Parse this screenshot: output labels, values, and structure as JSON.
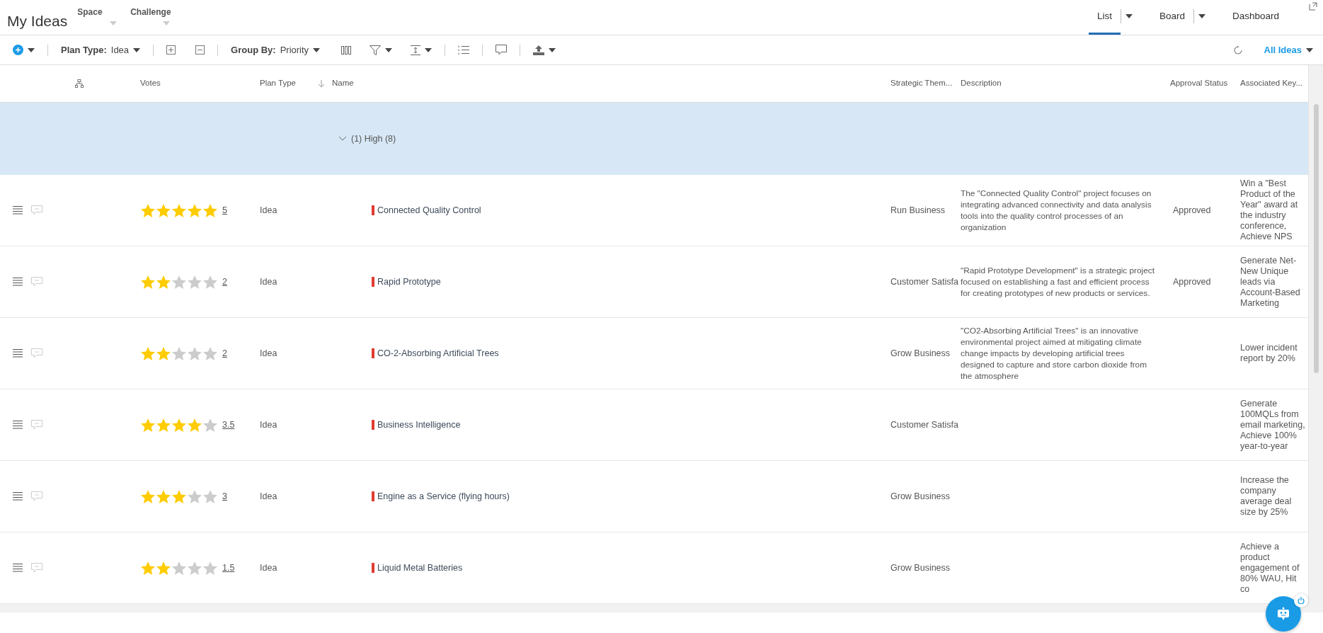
{
  "header": {
    "title": "My Ideas",
    "filters": [
      {
        "label": "Space"
      },
      {
        "label": "Challenge"
      }
    ],
    "views": [
      {
        "label": "List",
        "selected": true,
        "has_menu": true
      },
      {
        "label": "Board",
        "selected": false,
        "has_menu": true
      },
      {
        "label": "Dashboard",
        "selected": false,
        "has_menu": false
      }
    ]
  },
  "toolbar": {
    "plan_type": {
      "label": "Plan Type:",
      "value": "Idea"
    },
    "group_by": {
      "label": "Group By:",
      "value": "Priority"
    },
    "view_filter": "All Ideas"
  },
  "table": {
    "columns": [
      {
        "label": "Votes"
      },
      {
        "label": "Plan Type"
      },
      {
        "label": "Name",
        "sorted_descending": true
      },
      {
        "label": "Strategic Them..."
      },
      {
        "label": "Description"
      },
      {
        "label": "Approval Status"
      },
      {
        "label": "Associated Key..."
      }
    ],
    "group": {
      "label": "(1) High (8)",
      "expanded": true
    },
    "rows": [
      {
        "stars": 5,
        "votes": "5",
        "plan_type": "Idea",
        "name": "Connected Quality Control",
        "strategic_theme": "Run Business",
        "description": "The \"Connected Quality Control\" project focuses on integrating advanced connectivity and data analysis tools into the quality control processes of an organization",
        "approval_status": "Approved",
        "key_results": "Win a \"Best Product of the Year\" award at the industry conference, Achieve NPS"
      },
      {
        "stars": 2,
        "votes": "2",
        "plan_type": "Idea",
        "name": "Rapid Prototype",
        "strategic_theme": "Customer Satisfa",
        "description": "\"Rapid Prototype Development\" is a strategic project focused on establishing a fast and efficient process for creating prototypes of new products or services.",
        "approval_status": "Approved",
        "key_results": "Generate Net-New Unique leads via Account-Based Marketing"
      },
      {
        "stars": 2,
        "votes": "2",
        "plan_type": "Idea",
        "name": "CO-2-Absorbing Artificial Trees",
        "strategic_theme": "Grow Business",
        "description": "\"CO2-Absorbing Artificial Trees\" is an innovative environmental project aimed at mitigating climate change impacts by developing artificial trees designed to capture and store carbon dioxide from the atmosphere",
        "key_results": "Lower incident report by 20%"
      },
      {
        "stars": 4,
        "votes": "3.5",
        "plan_type": "Idea",
        "name": "Business Intelligence",
        "strategic_theme": "Customer Satisfa",
        "key_results": "Generate 100MQLs from email marketing, Achieve 100% year-to-year"
      },
      {
        "stars": 3,
        "votes": "3",
        "plan_type": "Idea",
        "name": "Engine as a Service (flying hours)",
        "strategic_theme": "Grow Business",
        "key_results": "Increase the company average deal size by 25%"
      },
      {
        "stars": 2,
        "votes": "1.5",
        "plan_type": "Idea",
        "name": "Liquid Metal Batteries",
        "strategic_theme": "Grow Business",
        "key_results": "Achieve a product engagement of 80% WAU, Hit co"
      }
    ]
  }
}
